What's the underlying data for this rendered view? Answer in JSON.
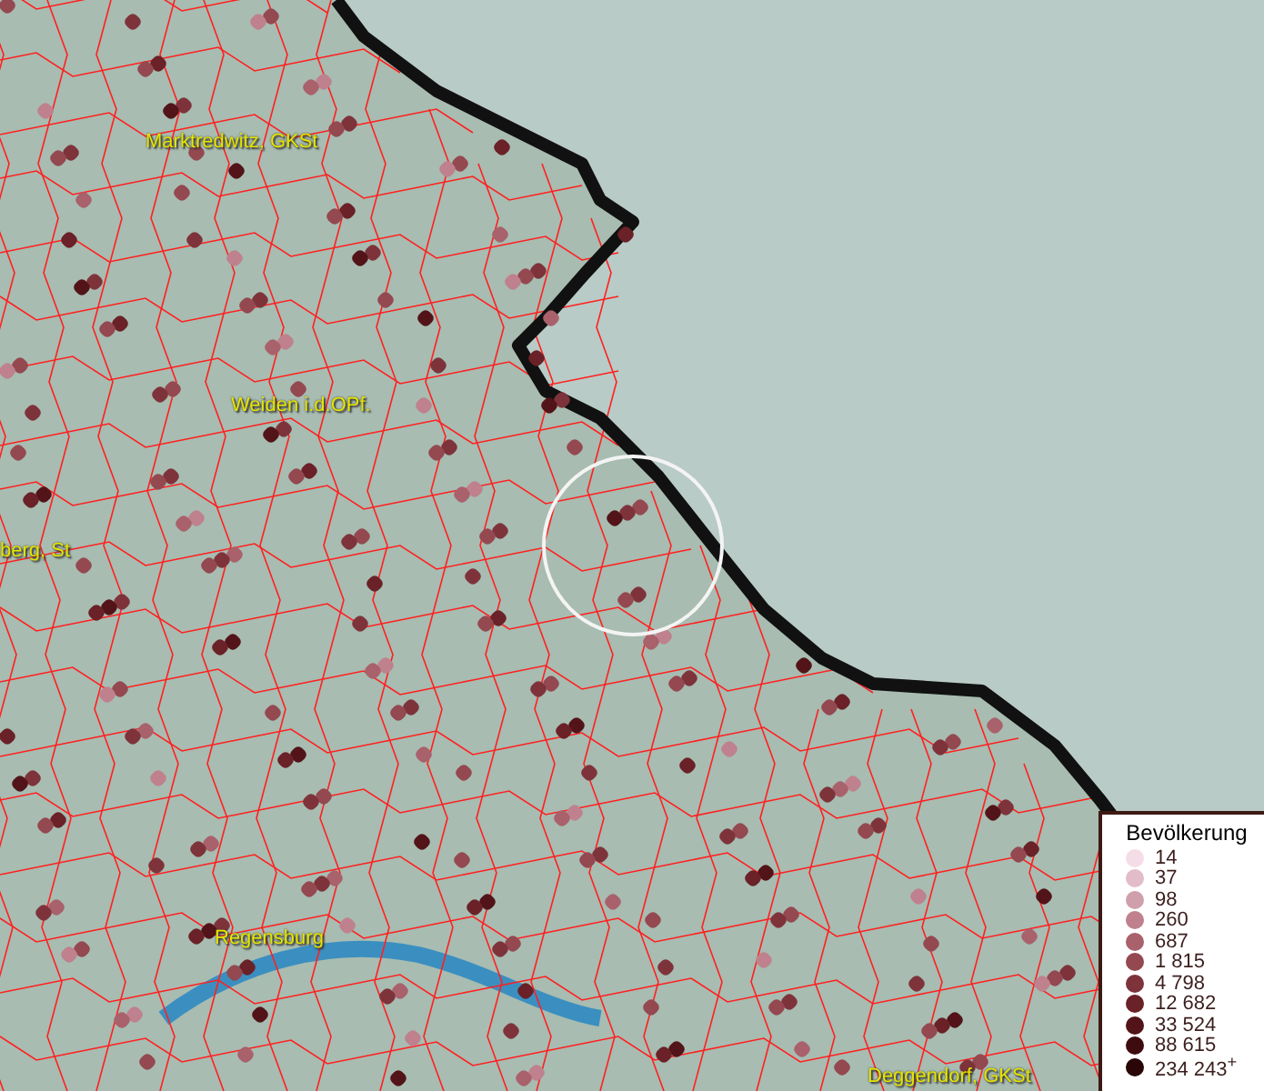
{
  "map": {
    "places": [
      {
        "name": "Marktredwitz, GKSt"
      },
      {
        "name": "Weiden i.d.OPf."
      },
      {
        "name": "berg, St"
      },
      {
        "name": "Regensburg"
      },
      {
        "name": "Deggendorf, GKSt"
      }
    ]
  },
  "legend": {
    "title": "Bevölkerung",
    "items": [
      {
        "label": "14",
        "color": "#f5dde8"
      },
      {
        "label": "37",
        "color": "#e2bcc8"
      },
      {
        "label": "98",
        "color": "#d09fac"
      },
      {
        "label": "260",
        "color": "#bf818d"
      },
      {
        "label": "687",
        "color": "#a9616c"
      },
      {
        "label": "1 815",
        "color": "#944850"
      },
      {
        "label": "4 798",
        "color": "#7e333b"
      },
      {
        "label": "12 682",
        "color": "#6a2127"
      },
      {
        "label": "33 524",
        "color": "#521418"
      },
      {
        "label": "88 615",
        "color": "#3e0c0e"
      },
      {
        "label": "234 243$^{+}$",
        "color": "#2a0608"
      }
    ]
  }
}
